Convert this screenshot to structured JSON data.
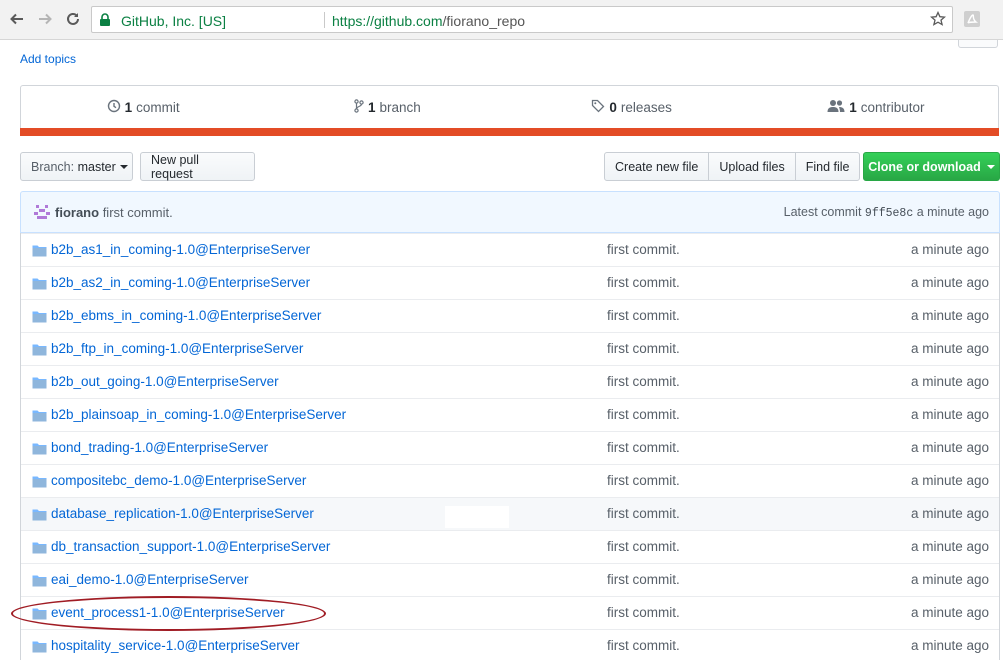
{
  "browser": {
    "site_owner": "GitHub, Inc. [US]",
    "url_scheme_host": "https://github.com",
    "url_path": "/fiorano_repo",
    "icons": [
      "back-arrow-icon",
      "forward-arrow-icon",
      "reload-icon",
      "lock-icon",
      "star-icon",
      "pdf-extension-icon"
    ]
  },
  "repo": {
    "add_topics_label": "Add topics",
    "stats": {
      "commits_count": "1",
      "commits_label": "commit",
      "branches_count": "1",
      "branches_label": "branch",
      "releases_count": "0",
      "releases_label": "releases",
      "contributors_count": "1",
      "contributors_label": "contributor"
    },
    "language_color": "#e34c26"
  },
  "toolbar": {
    "branch_prefix": "Branch:",
    "branch_name": "master",
    "new_pr_label": "New pull request",
    "create_file_label": "Create new file",
    "upload_files_label": "Upload files",
    "find_file_label": "Find file",
    "clone_label": "Clone or download"
  },
  "commit_tease": {
    "author": "fiorano",
    "message": "first commit.",
    "latest_label": "Latest commit",
    "sha": "9ff5e8c",
    "time": "a minute ago"
  },
  "files": [
    {
      "name": "b2b_as1_in_coming-1.0@EnterpriseServer",
      "message": "first commit.",
      "age": "a minute ago"
    },
    {
      "name": "b2b_as2_in_coming-1.0@EnterpriseServer",
      "message": "first commit.",
      "age": "a minute ago"
    },
    {
      "name": "b2b_ebms_in_coming-1.0@EnterpriseServer",
      "message": "first commit.",
      "age": "a minute ago"
    },
    {
      "name": "b2b_ftp_in_coming-1.0@EnterpriseServer",
      "message": "first commit.",
      "age": "a minute ago"
    },
    {
      "name": "b2b_out_going-1.0@EnterpriseServer",
      "message": "first commit.",
      "age": "a minute ago"
    },
    {
      "name": "b2b_plainsoap_in_coming-1.0@EnterpriseServer",
      "message": "first commit.",
      "age": "a minute ago"
    },
    {
      "name": "bond_trading-1.0@EnterpriseServer",
      "message": "first commit.",
      "age": "a minute ago"
    },
    {
      "name": "compositebc_demo-1.0@EnterpriseServer",
      "message": "first commit.",
      "age": "a minute ago"
    },
    {
      "name": "database_replication-1.0@EnterpriseServer",
      "message": "first commit.",
      "age": "a minute ago"
    },
    {
      "name": "db_transaction_support-1.0@EnterpriseServer",
      "message": "first commit.",
      "age": "a minute ago"
    },
    {
      "name": "eai_demo-1.0@EnterpriseServer",
      "message": "first commit.",
      "age": "a minute ago"
    },
    {
      "name": "event_process1-1.0@EnterpriseServer",
      "message": "first commit.",
      "age": "a minute ago"
    },
    {
      "name": "hospitality_service-1.0@EnterpriseServer",
      "message": "first commit.",
      "age": "a minute ago"
    }
  ],
  "colors": {
    "link": "#0366d6",
    "green_button": "#28a745",
    "annotation_ellipse": "#a01c24"
  }
}
